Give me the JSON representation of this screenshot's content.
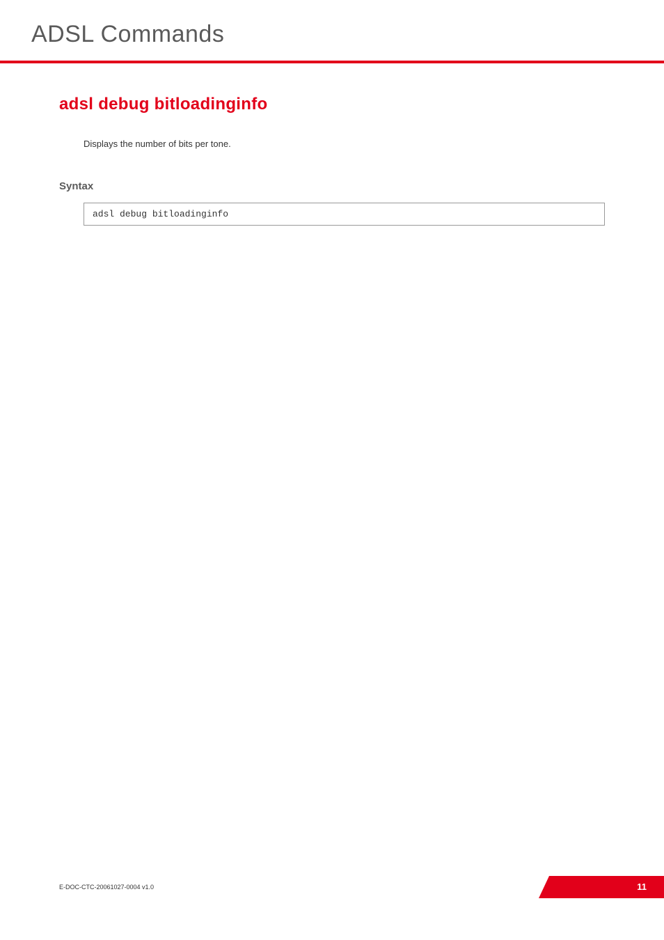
{
  "chapter": {
    "title": "ADSL Commands"
  },
  "command": {
    "title": "adsl debug bitloadinginfo",
    "description": "Displays the number of bits per tone."
  },
  "sections": {
    "syntax": {
      "heading": "Syntax",
      "code": "adsl debug bitloadinginfo"
    }
  },
  "footer": {
    "doc_reference": "E-DOC-CTC-20061027-0004 v1.0",
    "page_number": "11"
  },
  "colors": {
    "accent": "#e2001a",
    "heading_gray": "#5a5a5a"
  }
}
